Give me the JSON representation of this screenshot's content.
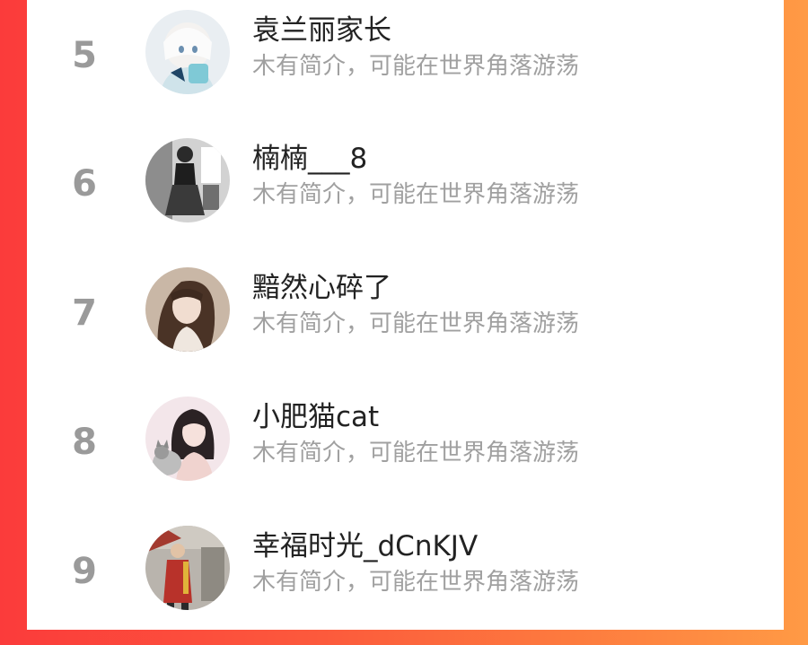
{
  "users": [
    {
      "rank": "5",
      "name": "袁兰丽家长",
      "bio": "木有简介，可能在世界角落游荡",
      "avatar_icon": "anime-girl-avatar-icon"
    },
    {
      "rank": "6",
      "name": "楠楠___8",
      "bio": "木有简介，可能在世界角落游荡",
      "avatar_icon": "grayscale-girl-avatar-icon"
    },
    {
      "rank": "7",
      "name": "黯然心碎了",
      "bio": "木有简介，可能在世界角落游荡",
      "avatar_icon": "long-hair-girl-avatar-icon"
    },
    {
      "rank": "8",
      "name": "小肥猫cat",
      "bio": "木有简介，可能在世界角落游荡",
      "avatar_icon": "girl-with-cat-avatar-icon"
    },
    {
      "rank": "9",
      "name": "幸福时光_dCnKJV",
      "bio": "木有简介，可能在世界角落游荡",
      "avatar_icon": "elderly-woman-avatar-icon"
    }
  ],
  "colors": {
    "background_left": "#fb3b3b",
    "background_right": "#ff9a45",
    "rank": "#9a9a9a",
    "name": "#222222",
    "bio": "#a0a0a0"
  }
}
